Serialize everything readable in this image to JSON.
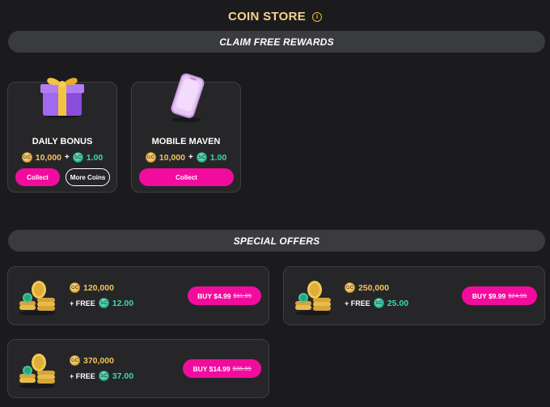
{
  "header": {
    "title": "COIN STORE",
    "info_icon": "info-icon"
  },
  "free_rewards": {
    "section_title": "CLAIM FREE REWARDS",
    "cards": [
      {
        "name": "DAILY BONUS",
        "gc_amount": "10,000",
        "plus": "+",
        "sc_amount": "1.00",
        "collect_label": "Collect",
        "more_label": "More Coins",
        "art": "gift-box-icon"
      },
      {
        "name": "MOBILE MAVEN",
        "gc_amount": "10,000",
        "plus": "+",
        "sc_amount": "1.00",
        "collect_label": "Collect",
        "art": "phone-icon"
      }
    ]
  },
  "special_offers": {
    "section_title": "SPECIAL OFFERS",
    "offers": [
      {
        "gc_amount": "120,000",
        "free_label": "+ FREE",
        "sc_amount": "12.00",
        "buy_label": "BUY $4.99",
        "old_price": "$11.99"
      },
      {
        "gc_amount": "250,000",
        "free_label": "+ FREE",
        "sc_amount": "25.00",
        "buy_label": "BUY $9.99",
        "old_price": "$24.99"
      },
      {
        "gc_amount": "370,000",
        "free_label": "+ FREE",
        "sc_amount": "37.00",
        "buy_label": "BUY $14.99",
        "old_price": "$36.99"
      }
    ]
  },
  "coin_labels": {
    "gc": "GC",
    "sc": "SC"
  },
  "colors": {
    "accent_pink": "#f20c9e",
    "gold": "#f4c35b",
    "teal": "#3ed8a8",
    "title": "#f7d28a",
    "background": "#1b1b1d",
    "card": "#262629"
  }
}
